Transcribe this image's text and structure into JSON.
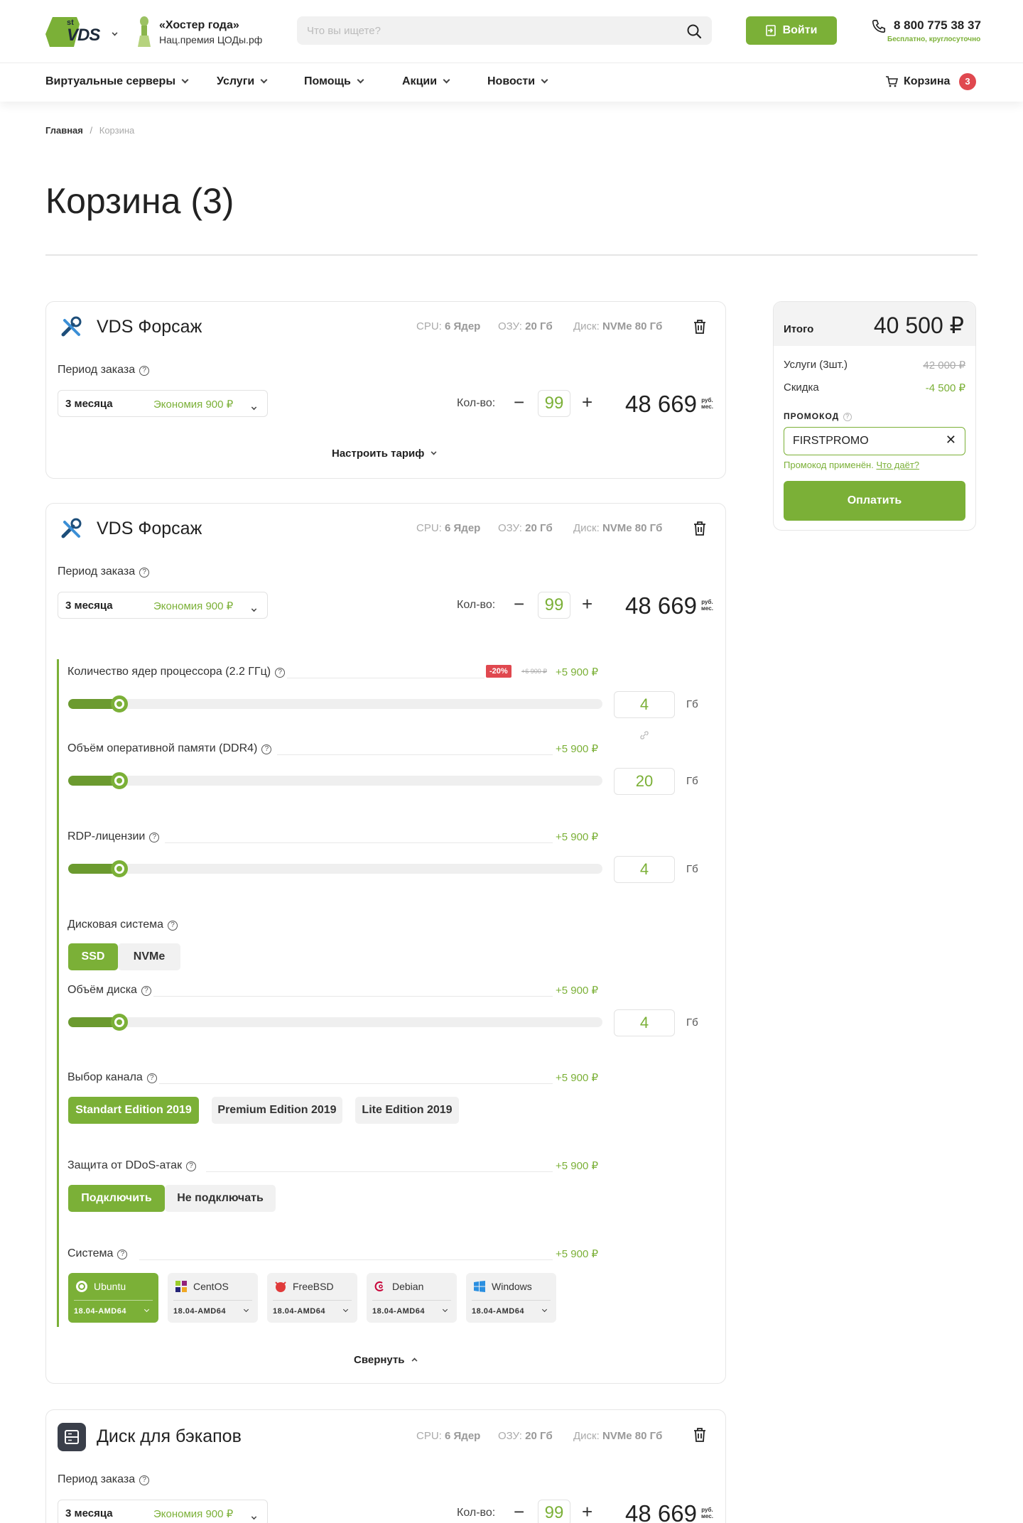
{
  "header": {
    "logo_text": "VDS",
    "logo_sup": "st",
    "award_title": "«Хостер года»",
    "award_sub": "Нац.премия ЦОДы.рф",
    "search_placeholder": "Что вы ищете?",
    "login_label": "Войти",
    "phone": "8 800 775 38 37",
    "phone_note": "Бесплатно, круглосуточно"
  },
  "nav": {
    "items": [
      "Виртуальные серверы",
      "Услуги",
      "Помощь",
      "Акции",
      "Новости"
    ],
    "cart_label": "Корзина",
    "cart_count": "3"
  },
  "breadcrumb": {
    "home": "Главная",
    "sep": "/",
    "current": "Корзина"
  },
  "page_title": "Корзина (3)",
  "cart_items": [
    {
      "title": "VDS Форсаж",
      "icon": "tools-icon",
      "cpu_label": "CPU:",
      "cpu_value": "6 Ядер",
      "ram_label": "ОЗУ:",
      "ram_value": "20 Гб",
      "disk_label": "Диск:",
      "disk_value": "NVMe 80 Гб",
      "period_label": "Период заказа",
      "period_value": "3 месяца",
      "period_saving": "Экономия 900 ₽",
      "qty_label": "Кол-во:",
      "qty": "99",
      "price": "48 669",
      "price_unit_top": "руб.",
      "price_unit_bottom": "мес.",
      "configure_label": "Настроить тариф"
    },
    {
      "title": "VDS Форсаж",
      "icon": "tools-icon",
      "cpu_label": "CPU:",
      "cpu_value": "6 Ядер",
      "ram_label": "ОЗУ:",
      "ram_value": "20 Гб",
      "disk_label": "Диск:",
      "disk_value": "NVMe 80 Гб",
      "period_label": "Период заказа",
      "period_value": "3 месяца",
      "period_saving": "Экономия 900 ₽",
      "qty_label": "Кол-во:",
      "qty": "99",
      "price": "48 669",
      "price_unit_top": "руб.",
      "price_unit_bottom": "мес.",
      "collapse_label": "Свернуть"
    },
    {
      "title": "Диск для бэкапов",
      "icon": "server-disk-icon",
      "cpu_label": "CPU:",
      "cpu_value": "6 Ядер",
      "ram_label": "ОЗУ:",
      "ram_value": "20 Гб",
      "disk_label": "Диск:",
      "disk_value": "NVMe 80 Гб",
      "period_label": "Период заказа",
      "period_value": "3 месяца",
      "period_saving": "Экономия 900 ₽",
      "qty_label": "Кол-во:",
      "qty": "99",
      "price": "48 669",
      "price_unit_top": "руб.",
      "price_unit_bottom": "мес."
    }
  ],
  "config": {
    "cpu": {
      "label": "Количество ядер процессора (2.2 ГГц)",
      "discount": "-20%",
      "old_price": "+6 900 ₽",
      "price": "+5 900 ₽",
      "value": "4",
      "unit": "Гб",
      "slider_fraction": 0.08
    },
    "ram": {
      "label": "Объём оперативной памяти (DDR4)",
      "price": "+5 900 ₽",
      "value": "20",
      "unit": "Гб",
      "slider_fraction": 0.08
    },
    "rdp": {
      "label": "RDP-лицензии",
      "price": "+5 900 ₽",
      "value": "4",
      "unit": "Гб",
      "slider_fraction": 0.08
    },
    "disk_system": {
      "label": "Дисковая система",
      "options": [
        "SSD",
        "NVMe"
      ],
      "selected": "SSD"
    },
    "disk_size": {
      "label": "Объём диска",
      "price": "+5 900 ₽",
      "value": "4",
      "unit": "Гб",
      "slider_fraction": 0.08
    },
    "channel": {
      "label": "Выбор канала",
      "price": "+5 900 ₽",
      "options": [
        "Standart Edition 2019",
        "Premium Edition 2019",
        "Lite Edition 2019"
      ],
      "selected": "Standart Edition 2019"
    },
    "ddos": {
      "label": "Защита от DDoS-атак",
      "price": "+5 900 ₽",
      "options": [
        "Подключить",
        "Не подключать"
      ],
      "selected": "Подключить"
    },
    "os": {
      "label": "Система",
      "price": "+5 900 ₽",
      "options": [
        {
          "name": "Ubuntu",
          "version": "18.04-AMD64",
          "icon": "ubuntu-icon"
        },
        {
          "name": "CentOS",
          "version": "18.04-AMD64",
          "icon": "centos-icon"
        },
        {
          "name": "FreeBSD",
          "version": "18.04-AMD64",
          "icon": "freebsd-icon"
        },
        {
          "name": "Debian",
          "version": "18.04-AMD64",
          "icon": "debian-icon"
        },
        {
          "name": "Windows",
          "version": "18.04-AMD64",
          "icon": "windows-icon"
        }
      ],
      "selected": "Ubuntu"
    }
  },
  "summary": {
    "total_label": "Итого",
    "total": "40 500 ₽",
    "services_label": "Услуги (3шт.)",
    "services_old": "42 000 ₽",
    "discount_label": "Скидка",
    "discount": "-4 500 ₽",
    "promo_label": "ПРОМОКОД",
    "promo_value": "FIRSTPROMO",
    "promo_applied": "Промокод применён.",
    "promo_link": "Что даёт?",
    "pay_label": "Оплатить"
  },
  "colors": {
    "accent": "#7bb037",
    "badge_red": "#e0484f",
    "text": "#222222"
  }
}
